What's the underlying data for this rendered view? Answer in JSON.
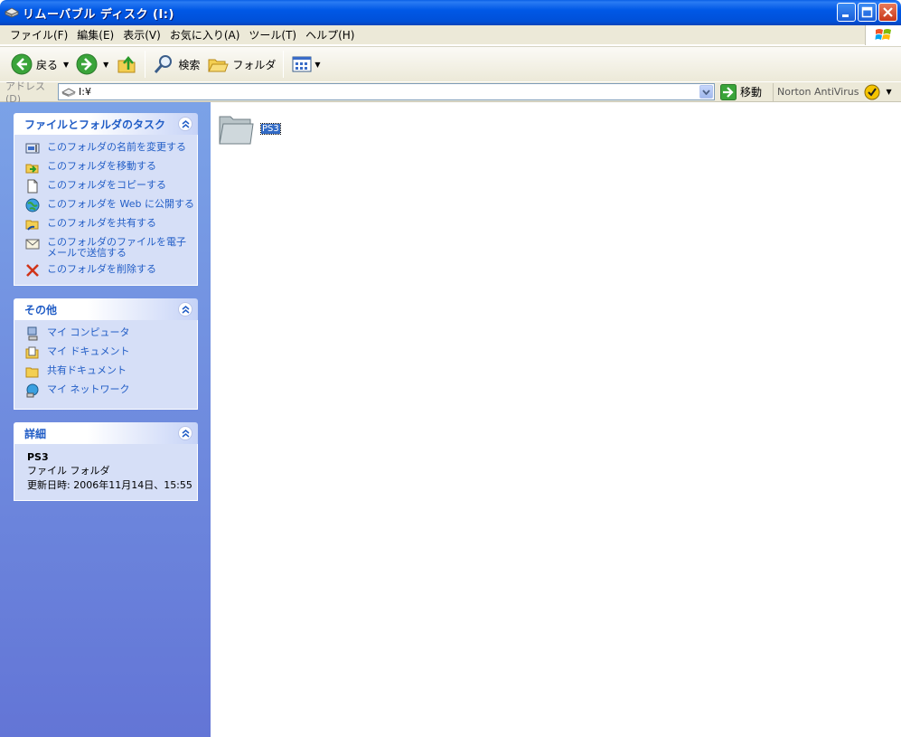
{
  "window": {
    "title": "リムーバブル ディスク (I:)"
  },
  "menu": {
    "items": [
      "ファイル(F)",
      "編集(E)",
      "表示(V)",
      "お気に入り(A)",
      "ツール(T)",
      "ヘルプ(H)"
    ]
  },
  "toolbar": {
    "back_label": "戻る",
    "search_label": "検索",
    "folders_label": "フォルダ"
  },
  "address": {
    "label": "アドレス(D)",
    "value": "I:¥",
    "go_label": "移動",
    "norton_label": "Norton AntiVirus"
  },
  "tasks_panel": {
    "title": "ファイルとフォルダのタスク",
    "items": [
      {
        "label": "このフォルダの名前を変更する",
        "icon": "rename-icon"
      },
      {
        "label": "このフォルダを移動する",
        "icon": "move-icon"
      },
      {
        "label": "このフォルダをコピーする",
        "icon": "copy-icon"
      },
      {
        "label": "このフォルダを Web に公開する",
        "icon": "publish-web-icon"
      },
      {
        "label": "このフォルダを共有する",
        "icon": "share-icon"
      },
      {
        "label": "このフォルダのファイルを電子メールで送信する",
        "icon": "email-icon"
      },
      {
        "label": "このフォルダを削除する",
        "icon": "delete-icon"
      }
    ]
  },
  "other_panel": {
    "title": "その他",
    "items": [
      {
        "label": "マイ コンピュータ",
        "icon": "my-computer-icon"
      },
      {
        "label": "マイ ドキュメント",
        "icon": "my-documents-icon"
      },
      {
        "label": "共有ドキュメント",
        "icon": "shared-documents-icon"
      },
      {
        "label": "マイ ネットワーク",
        "icon": "my-network-icon"
      }
    ]
  },
  "details_panel": {
    "title": "詳細",
    "name": "PS3",
    "type": "ファイル フォルダ",
    "modified": "更新日時: 2006年11月14日、15:55"
  },
  "content": {
    "items": [
      {
        "name": "PS3",
        "type": "folder",
        "selected": true
      }
    ]
  },
  "colors": {
    "title_bar": "#0058e6",
    "task_link": "#215dc6",
    "left_pane_top": "#7ba2e7",
    "left_pane_bottom": "#6375d6",
    "selection": "#316ac5"
  }
}
